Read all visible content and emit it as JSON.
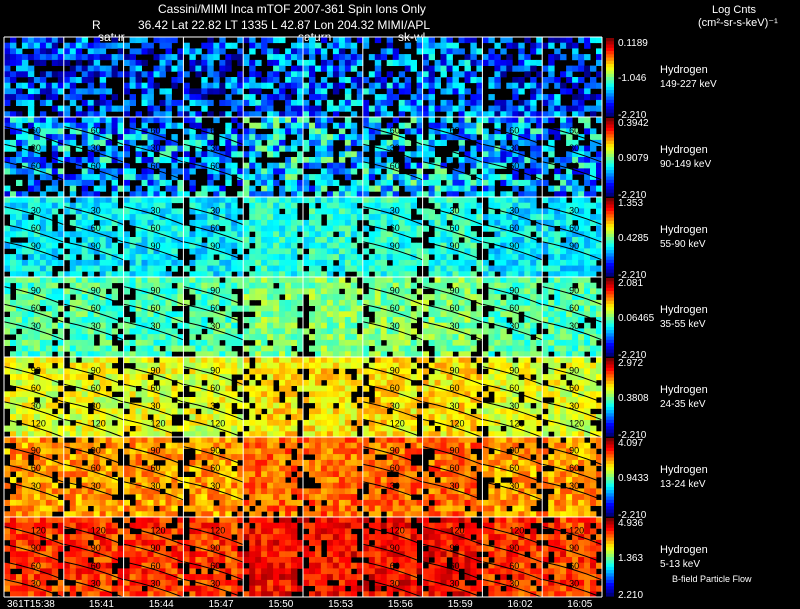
{
  "header": {
    "title": "Cassini/MIMI Inca mTOF  2007-361   Spin    Ions Only",
    "r_label": "R",
    "position_line": "36.42 Lat 22.82 LT 1335 L       42.87 Lon       204.32  MIMI/APL",
    "overlay_labels": [
      "satur",
      "saturn",
      "sk-wl"
    ],
    "units_title": "Log Cnts",
    "units": "(cm²-sr-s-keV)⁻¹"
  },
  "footer_note": "B-field Particle Flow",
  "chart_data": {
    "type": "heatmap",
    "species": "Hydrogen",
    "time_labels": [
      "361T15:38",
      "15:41",
      "15:44",
      "15:47",
      "15:50",
      "15:53",
      "15:56",
      "15:59",
      "16:02",
      "16:05"
    ],
    "rows": [
      {
        "name": "Hydrogen",
        "energy": "149-227 keV",
        "cmax": "0.1189",
        "cmid": "-1.046",
        "cmin": "-2.210",
        "level": 0.18,
        "contours": []
      },
      {
        "name": "Hydrogen",
        "energy": "90-149 keV",
        "cmax": "0.3942",
        "cmid": "0.9079",
        "cmin": "-2.210",
        "level": 0.28,
        "contours": [
          "60",
          "30",
          "60"
        ]
      },
      {
        "name": "Hydrogen",
        "energy": "55-90 keV",
        "cmax": "1.353",
        "cmid": "0.4285",
        "cmin": "-2.210",
        "level": 0.36,
        "contours": [
          "30",
          "60",
          "90"
        ]
      },
      {
        "name": "Hydrogen",
        "energy": "35-55 keV",
        "cmax": "2.081",
        "cmid": "0.06465",
        "cmin": "-2.210",
        "level": 0.45,
        "contours": [
          "90",
          "60",
          "30"
        ]
      },
      {
        "name": "Hydrogen",
        "energy": "24-35 keV",
        "cmax": "2.972",
        "cmid": "0.3808",
        "cmin": "-2.210",
        "level": 0.6,
        "contours": [
          "90",
          "60",
          "30",
          "120"
        ]
      },
      {
        "name": "Hydrogen",
        "energy": "13-24 keV",
        "cmax": "4.097",
        "cmid": "0.9433",
        "cmin": "-2.210",
        "level": 0.72,
        "contours": [
          "90",
          "60",
          "30"
        ]
      },
      {
        "name": "Hydrogen",
        "energy": "5-13 keV",
        "cmax": "4.936",
        "cmid": "1.363",
        "cmin": "2.210",
        "level": 0.82,
        "contours": [
          "120",
          "90",
          "60",
          "30"
        ]
      }
    ]
  }
}
